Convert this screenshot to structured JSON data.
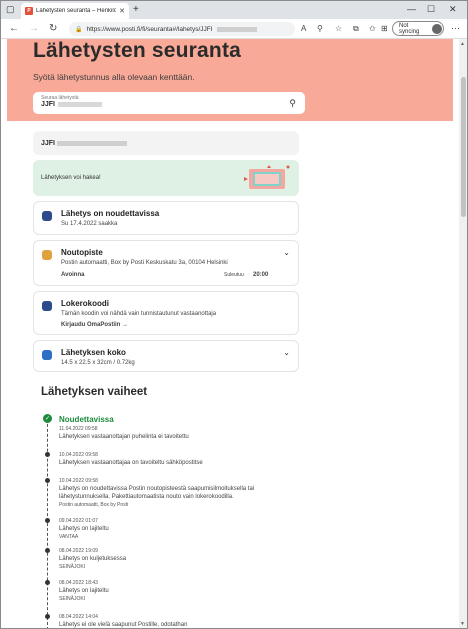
{
  "browser": {
    "tab_title": "Lähetysten seuranta – Henkilöi",
    "url_prefix": "https://www.posti.fi/fi/seuranta#/lahetys/JJFI",
    "sync_label": "Not syncing",
    "favicon_letter": "P"
  },
  "hero": {
    "title": "Lähetysten seuranta",
    "subtitle": "Syötä lähetystunnus alla olevaan kenttään.",
    "search_label": "Seuraa lähetystä",
    "search_value": "JJFI"
  },
  "shipment": {
    "id_prefix": "JJFI",
    "success_text": "Lähetyksen voi hakea!"
  },
  "cards": {
    "status": {
      "title": "Lähetys on noudettavissa",
      "subtitle": "Su 17.4.2022 saakka"
    },
    "pickup": {
      "title": "Noutopiste",
      "address": "Postin automaatti, Box by Posti Keskuskatu 3a, 00104 Helsinki",
      "open": "Avoinna",
      "closes_label": "Suleutuu",
      "closes_time": "20:00"
    },
    "locker": {
      "title": "Lokerokoodi",
      "subtitle": "Tämän koodin voi nähdä vain tunnistautunut vastaanottaja",
      "link": "Kirjaudu OmaPostiin"
    },
    "size": {
      "title": "Lähetyksen koko",
      "subtitle": "14.5 x 22.5 x 32cm / 0.72kg"
    }
  },
  "timeline": {
    "heading": "Lähetyksen vaiheet",
    "events": [
      {
        "status": "Noudettavissa",
        "date": "11.04.2022 09:58",
        "lines": [
          "Lähetyksen vastaanottajan puhelinta ei tavoitettu"
        ],
        "loc": ""
      },
      {
        "status": "",
        "date": "10.04.2022 09:58",
        "lines": [
          "Lähetyksen vastaanottajaa on tavoiteltu sähköpostitse"
        ],
        "loc": ""
      },
      {
        "status": "",
        "date": "10.04.2022 09:58",
        "lines": [
          "Lähetys on noudettavissa Postin noutopisteestä saapumisilmoituksella tai",
          "lähetystunnuksella. Pakettiautomaatista nouto vain lokerokoodilla."
        ],
        "loc": "Postin automaatti, Box by Posti"
      },
      {
        "status": "",
        "date": "09.04.2022 01:07",
        "lines": [
          "Lähetys on lajiteltu"
        ],
        "loc": "VANTAA"
      },
      {
        "status": "",
        "date": "08.04.2022 19:09",
        "lines": [
          "Lähetys on kuljetuksessa"
        ],
        "loc": "SEINÄJOKI"
      },
      {
        "status": "",
        "date": "08.04.2022 18:43",
        "lines": [
          "Lähetys on lajiteltu"
        ],
        "loc": "SEINÄJOKI"
      },
      {
        "status": "",
        "date": "08.04.2022 14:04",
        "lines": [
          "Lähetys ei ole vielä saapunut Postille, odotathan"
        ],
        "loc": ""
      }
    ]
  },
  "colors": {
    "hero": "#f8a998",
    "success_bg": "#dff0e4",
    "green": "#1d8a3c",
    "link": "#1c4fa0"
  }
}
